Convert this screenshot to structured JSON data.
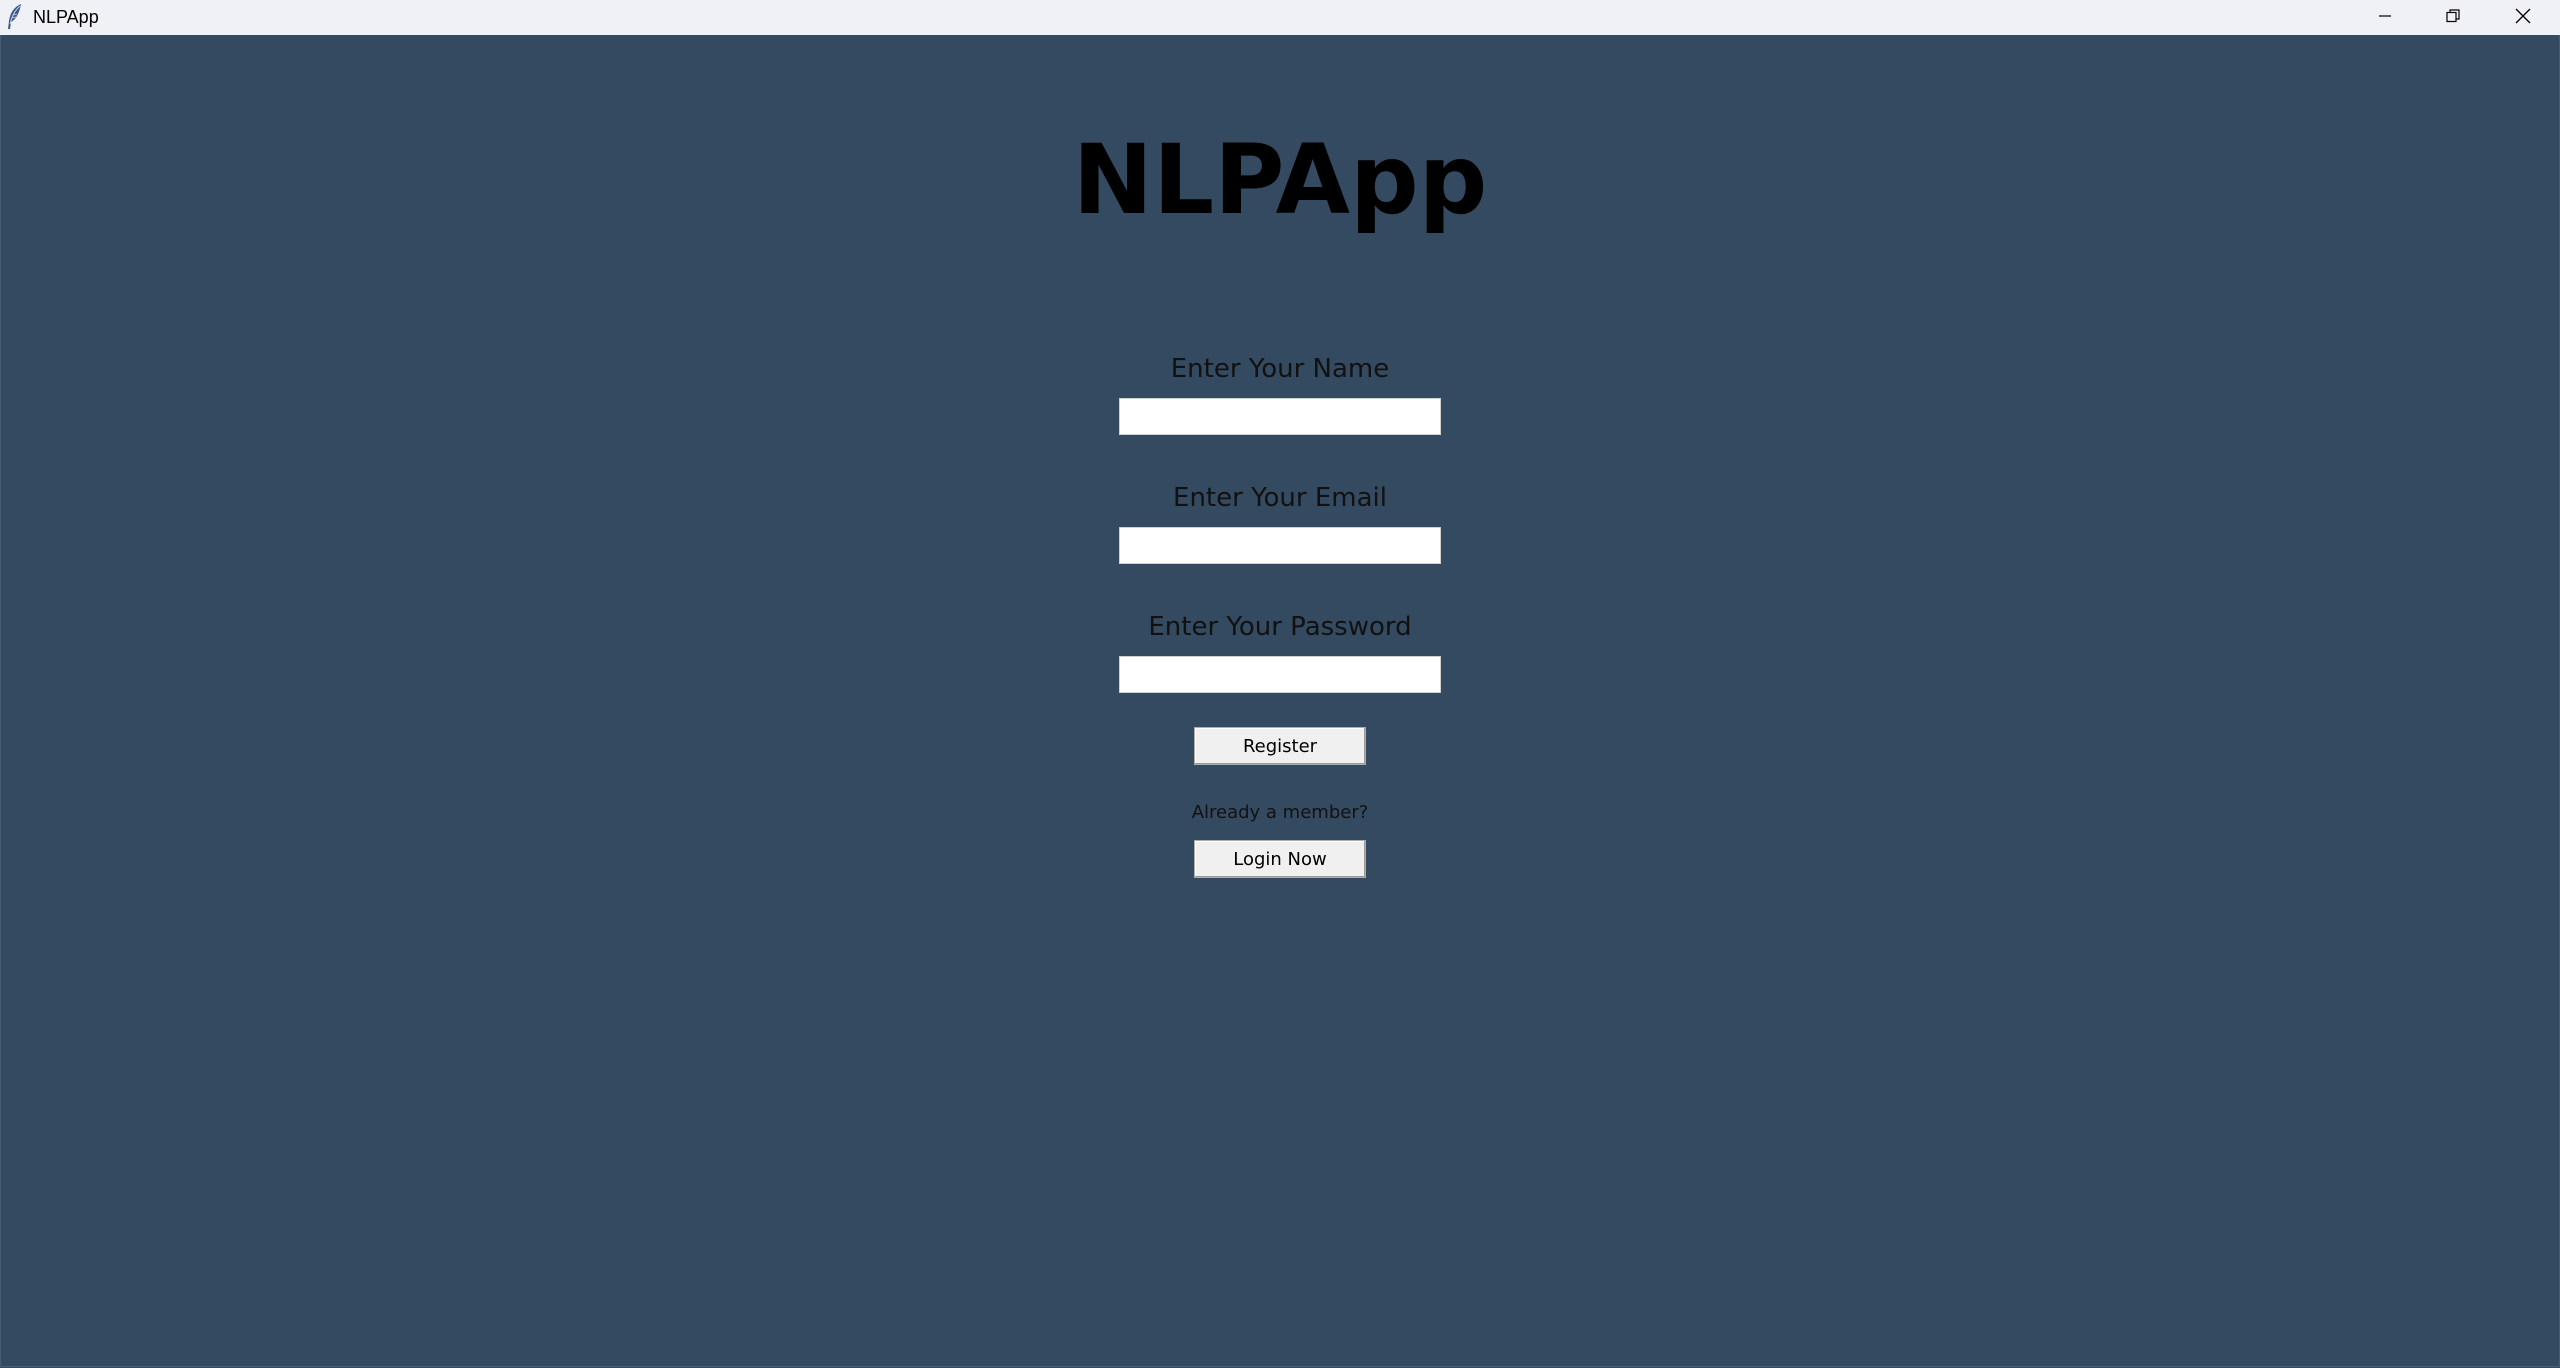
{
  "window": {
    "title": "NLPApp",
    "app_icon": "feather-icon",
    "controls": {
      "minimize_icon": "minimize-icon",
      "maximize_icon": "restore-icon",
      "close_icon": "close-icon"
    }
  },
  "colors": {
    "background": "#344a60",
    "titlebar": "#f0f1f7"
  },
  "main": {
    "heading": "NLPApp",
    "name_label": "Enter Your Name",
    "name_value": "",
    "email_label": "Enter Your Email",
    "email_value": "",
    "password_label": "Enter Your Password",
    "password_value": "",
    "register_label": "Register",
    "member_prompt": "Already a member?",
    "login_label": "Login Now"
  }
}
